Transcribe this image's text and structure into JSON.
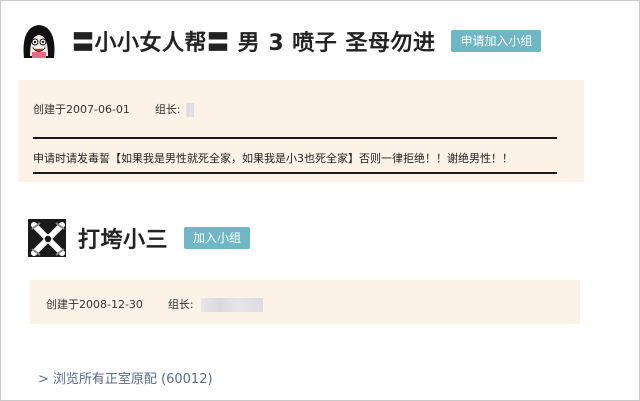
{
  "groups": [
    {
      "title": "〓小小女人帮〓 男 3 喷子 圣母勿进",
      "join_label": "申请加入小组",
      "created": "创建于2007-06-01",
      "leader_label": "组长:",
      "notice": "申请时请发毒誓【如果我是男性就死全家，如果我是小3也死全家】否则一律拒绝！！谢绝男性！！"
    },
    {
      "title": "打垮小三",
      "join_label": "加入小组",
      "created": "创建于2008-12-30",
      "leader_label": "组长:"
    }
  ],
  "browse_link": {
    "arrow": ">",
    "text": "浏览所有正室原配 (60012)",
    "color": "#5a6b8c"
  },
  "colors": {
    "panel_bg": "#fdf2e7",
    "button_bg": "#6fb7c4"
  }
}
